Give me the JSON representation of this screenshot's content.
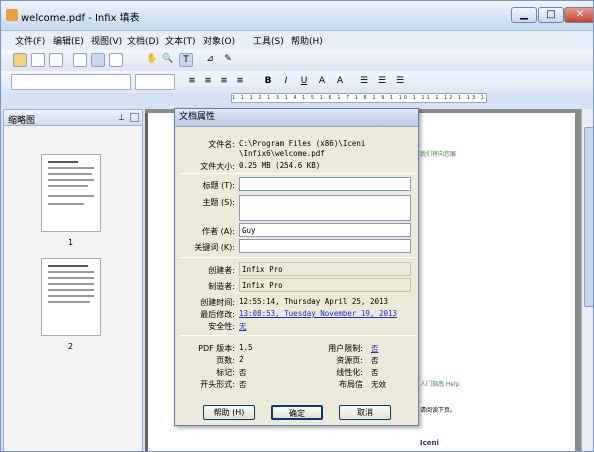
{
  "window": {
    "title": "welcome.pdf - Infix 填表",
    "minimize_label": "▁",
    "maximize_label": "□",
    "close_label": "✕"
  },
  "menu": [
    "文件(F)",
    "编辑(E)",
    "视图(V)",
    "文档(D)",
    "文本(T)",
    "对象(O)",
    "工具(S)",
    "帮助(H)"
  ],
  "toolbar2": {
    "bold": "B",
    "italic": "I",
    "underline": "U",
    "superscript": "A",
    "subscript": "A"
  },
  "ruler_text": "1 1 1 2 1 3 1 4 1 5 1 6 1 7 1 8 1 9 1 10 1 11 1 12 1 13 1 14 1 15 1 16",
  "thumbnails": {
    "panel_title": "缩略图",
    "pages": [
      "1",
      "2"
    ]
  },
  "page_text": [
    "我们将向您展",
    "",
    "",
    "",
    "",
    "",
    "",
    "人门指南 Help",
    "",
    "请阅读下页。"
  ],
  "page_footer": "Iceni",
  "dialog": {
    "title": "文档属性",
    "file_name_label": "文件名:",
    "file_name": "C:\\Program Files (x86)\\Iceni\\Infix6\\welcome.pdf",
    "file_name_line1": "C:\\Program Files (x86)\\Iceni",
    "file_name_line2": "\\Infix6\\welcome.pdf",
    "file_size_label": "文件大小:",
    "file_size": "0.25 MB (254.6 KB)",
    "title_label": "标题 (T):",
    "title_value": "",
    "subject_label": "主题 (S):",
    "subject_value": "",
    "author_label": "作者 (A):",
    "author_value": "Guy",
    "keywords_label": "关键词 (K):",
    "keywords_value": "",
    "creator_label": "创建者:",
    "creator_value": "Infix Pro",
    "producer_label": "制造者:",
    "producer_value": "Infix Pro",
    "created_label": "创建时间:",
    "created_value": "12:55:14, Thursday April 25, 2013",
    "modified_label": "最后修改:",
    "modified_value": "13:08:53, Tuesday November 19, 2013",
    "security_label": "安全性:",
    "security_value": "无",
    "pdf_version_label": "PDF 版本:",
    "pdf_version": "1.5",
    "pages_label": "页数:",
    "pages_value": "2",
    "tagged_label": "标记:",
    "tagged_value": "否",
    "start_form_label": "开头形式:",
    "start_form_value": "否",
    "user_restrictions_label": "用户限制:",
    "user_restrictions_value": "否",
    "resource_pages_label": "资源页:",
    "resource_pages_value": "否",
    "linearized_label": "线性化:",
    "linearized_value": "否",
    "layout_info_label": "布局信",
    "layout_info_value": "无效",
    "help_button": "帮助 (H)",
    "ok_button": "确定",
    "cancel_button": "取消"
  }
}
